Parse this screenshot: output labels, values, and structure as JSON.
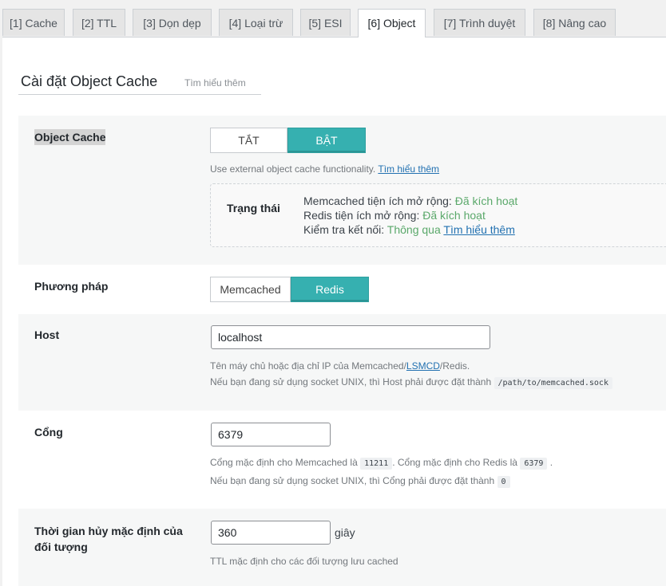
{
  "tabs": [
    "[1] Cache",
    "[2] TTL",
    "[3] Dọn dẹp",
    "[4] Loại trừ",
    "[5] ESI",
    "[6] Object",
    "[7] Trình duyệt",
    "[8] Nâng cao"
  ],
  "section": {
    "title": "Cài đặt Object Cache",
    "learn_more": "Tìm hiểu thêm"
  },
  "object_cache": {
    "label": "Object Cache",
    "off": "TẮT",
    "on": "BẬT",
    "desc": "Use external object cache functionality.",
    "desc_link": "Tìm hiểu thêm",
    "status_title": "Trạng thái",
    "line1_label": "Memcached tiện ích mở rộng:",
    "line1_value": "Đã kích hoạt",
    "line2_label": "Redis tiện ích mở rộng:",
    "line2_value": "Đã kích hoạt",
    "line3_label": "Kiểm tra kết nối:",
    "line3_value": "Thông qua",
    "line3_link": "Tìm hiểu thêm"
  },
  "method": {
    "label": "Phương pháp",
    "opt1": "Memcached",
    "opt2": "Redis"
  },
  "host": {
    "label": "Host",
    "value": "localhost",
    "desc1_a": "Tên máy chủ hoặc địa chỉ IP của Memcached/",
    "desc1_link": "LSMCD",
    "desc1_b": "/Redis.",
    "desc2": "Nếu bạn đang sử dụng socket UNIX, thì Host phải được đặt thành",
    "desc2_code": "/path/to/memcached.sock"
  },
  "port": {
    "label": "Cổng",
    "value": "6379",
    "desc1_a": "Cổng mặc định cho Memcached là",
    "code1": "11211",
    "desc1_b": ". Cổng mặc định cho Redis là",
    "code2": "6379",
    "desc1_c": ".",
    "desc2": "Nếu bạn đang sử dụng socket UNIX, thì Cổng phải được đặt thành",
    "code3": "0"
  },
  "ttl": {
    "label": "Thời gian hủy mặc định của đối tượng",
    "value": "360",
    "unit": "giây",
    "desc": "TTL mặc định cho các đối tượng lưu cached"
  }
}
